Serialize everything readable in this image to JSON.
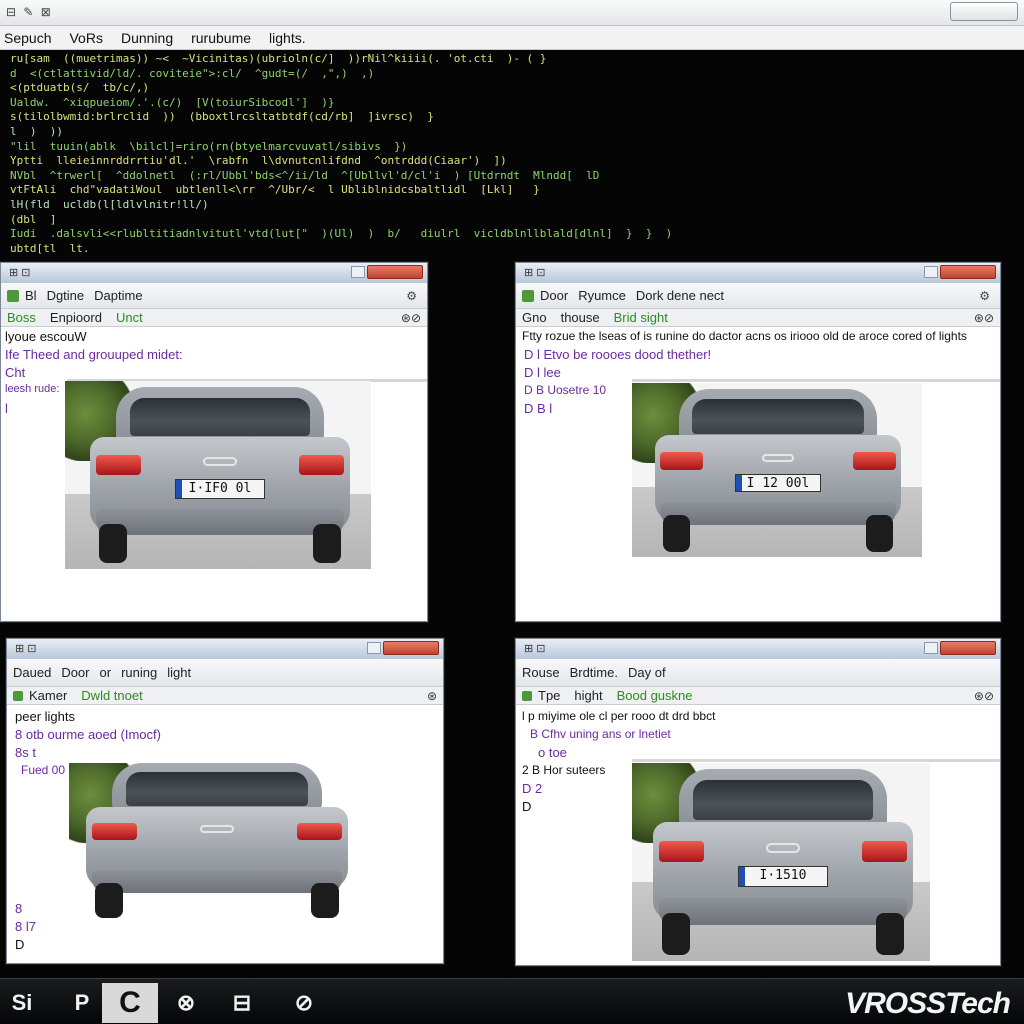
{
  "menubar": {
    "items": [
      "Sepuch",
      "VoRs",
      "Dunning",
      "rurubume",
      "lights."
    ]
  },
  "console": {
    "lines": [
      "ru[sam  ((muetrimas)) ~<  ~Vicinitas)(ubrioln(c/]  ))rNil^kiiii(. 'ot.cti  )- ( }",
      "d  <(ctlattivid/ld/. coviteie\">:cl/  ^gudt=(/  ,\",)  ,)",
      "<(ptduatb(s/  tb/c/,)",
      "Ualdw.  ^xiqpueiom/.'.(c/)  [V(toiurSibcodl']  )}",
      "s(tilolbwmid:brlrclid  ))  (bboxtlrcsltatbtdf(cd/rb]  ]ivrsc)  }",
      "l  )  ))",
      "\"lil  tuuin(ablk  \\bilcl]=riro(rn(btyelmarcvuvatl/sibivs  })",
      "Yptti  lleieinnrddrrtiu'dl.'  \\rabfn  l\\dvnutcnlifdnd  ^ontrddd(Ciaar')  ])",
      "NVbl  ^trwerl[  ^ddolnetl  (:rl/Ubbl'bds<^/ii/ld  ^[Ubllvl'd/cl'i  ) [Utdrndt  Mlndd[  lD",
      "vtFtAli  chd\"vadatiWoul  ubtlenll<\\rr  ^/Ubr/<  l Ubliblnidcsbaltlidl  [Lkl]   }",
      "lH(fld  ucldb(l[ldlvlnitr!ll/)",
      "(dbl  ]",
      "Iudi  .dalsvli<<rlubltitiadnlvitutl'vtd(lut[\"  )(Ul)  )  b/   diulrl  vicldblnllblald[dlnl]  }  }  )",
      "ubtd[tl  lt."
    ]
  },
  "windows": [
    {
      "toolbar": [
        "Bl",
        "Dgtine",
        "Daptime"
      ],
      "tabs": [
        "Boss",
        "Enpioord",
        "Unct"
      ],
      "lines": [
        "lyoue escouW",
        "Ife     Theed and grouuped midet:",
        "Cht",
        "leesh  rude:",
        "l"
      ],
      "plate": "I·IF0 0l"
    },
    {
      "toolbar": [
        "Door",
        "Ryumce",
        "Dork dene nect"
      ],
      "tabs": [
        "Gno",
        "thouse",
        "Brid sight"
      ],
      "lines": [
        "Ftty rozue the lseas of is runine do dactor acns os iriooo old de aroce cored of lights",
        "D  l  Etvo  be roooes dood thether!",
        "D   l  lee",
        "D  B  Uosetre  10",
        "D  B  l"
      ],
      "plate": "I 12 00l"
    },
    {
      "toolbar": [
        "Daued",
        "Door",
        "or",
        "runing",
        "light"
      ],
      "tabs": [
        "Kamer",
        "Dwld tnoet"
      ],
      "lines": [
        "peer lights",
        "8   otb ourme aoed (Imocf)",
        "8s   t",
        "Fued  00",
        "8",
        "8  l7",
        "D"
      ],
      "plate": ""
    },
    {
      "toolbar": [
        "Rouse",
        "Brdtime.",
        "Day of"
      ],
      "tabs": [
        "Tpe",
        "hight",
        "Bood guskne"
      ],
      "lines": [
        "l p miyime ole cl per rooo dt drd bbct",
        "B    Cfhv uning ans or lnetiet",
        "o        toe",
        "2  B   Hor suteers",
        "D   2",
        "D"
      ],
      "plate": "I·1510"
    }
  ],
  "taskbar": {
    "buttons": [
      "Si",
      "P",
      "C",
      "⊗",
      "⊟",
      "⊘"
    ],
    "brand": "VROSSTech"
  }
}
